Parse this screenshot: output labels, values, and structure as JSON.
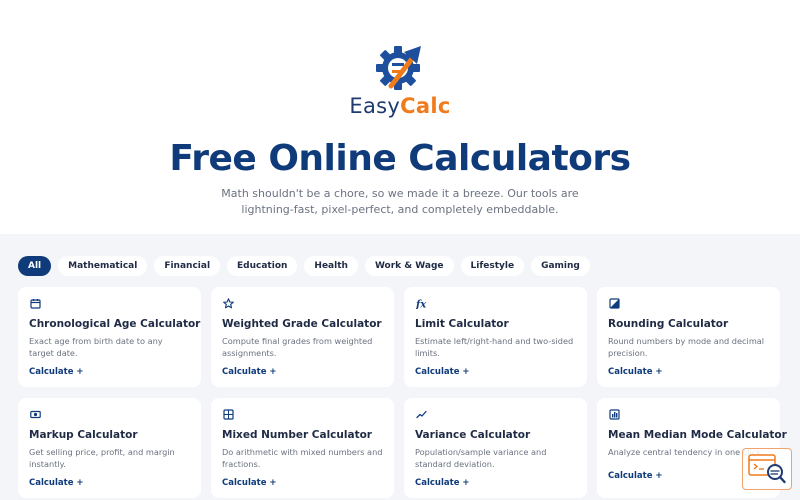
{
  "brand": {
    "easy": "Easy",
    "calc": "Calc"
  },
  "hero": {
    "title": "Free Online Calculators",
    "subtitle": "Math shouldn't be a chore, so we made it a breeze. Our tools are lightning-fast, pixel-perfect, and completely embeddable."
  },
  "filters": [
    "All",
    "Mathematical",
    "Financial",
    "Education",
    "Health",
    "Work & Wage",
    "Lifestyle",
    "Gaming"
  ],
  "cards": [
    {
      "icon": "calendar-icon",
      "title": "Chronological Age Calculator",
      "desc": "Exact age from birth date to any target date.",
      "link": "Calculate +"
    },
    {
      "icon": "star-icon",
      "title": "Weighted Grade Calculator",
      "desc": "Compute final grades from weighted assignments.",
      "link": "Calculate +"
    },
    {
      "icon": "function-icon",
      "title": "Limit Calculator",
      "desc": "Estimate left/right-hand and two-sided limits.",
      "link": "Calculate +"
    },
    {
      "icon": "rounding-icon",
      "title": "Rounding Calculator",
      "desc": "Round numbers by mode and decimal precision.",
      "link": "Calculate +"
    },
    {
      "icon": "money-icon",
      "title": "Markup Calculator",
      "desc": "Get selling price, profit, and margin instantly.",
      "link": "Calculate +"
    },
    {
      "icon": "grid-icon",
      "title": "Mixed Number Calculator",
      "desc": "Do arithmetic with mixed numbers and fractions.",
      "link": "Calculate +"
    },
    {
      "icon": "trend-icon",
      "title": "Variance Calculator",
      "desc": "Population/sample variance and standard deviation.",
      "link": "Calculate +"
    },
    {
      "icon": "chart-icon",
      "title": "Mean Median Mode Calculator",
      "desc": "Analyze central tendency in one click.",
      "link": "Calculate +"
    }
  ],
  "colors": {
    "primary": "#0f3b7a",
    "accent": "#f07b1a",
    "background": "#f3f5f9"
  }
}
